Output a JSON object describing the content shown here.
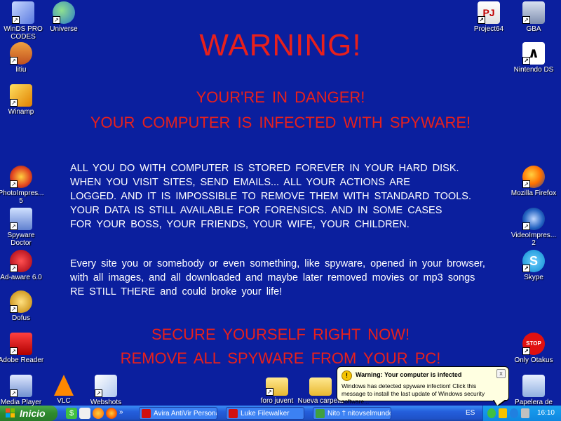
{
  "warning": {
    "title": "WARNING!",
    "danger": "YOUR'RE IN DANGER!",
    "infected": "YOUR COMPUTER IS INFECTED WITH SPYWARE!",
    "para1": [
      "ALL YOU DO WITH COMPUTER IS STORED FOREVER IN YOUR HARD DISK.",
      "WHEN YOU VISIT SITES, SEND EMAILS... ALL YOUR ACTIONS ARE",
      "LOGGED. AND IT IS IMPOSSIBLE TO REMOVE THEM WITH STANDARD TOOLS.",
      "YOUR DATA IS STILL AVAILABLE FOR FORENSICS. AND IN SOME CASES",
      "FOR YOUR BOSS, YOUR FRIENDS, YOUR WIFE, YOUR CHILDREN."
    ],
    "para2": [
      "Every site you or somebody or even something, like spyware, opened in your browser,",
      "with all images, and all downloaded and maybe later removed movies or mp3 songs",
      "RE STILL THERE and could broke your life!"
    ],
    "secure": "SECURE YOURSELF RIGHT NOW!",
    "remove": "REMOVE ALL SPYWARE FROM YOUR PC!"
  },
  "icons": {
    "winds": "WinDS PRO CODES",
    "universe": "Universe",
    "project64": "Project64",
    "gba": "GBA",
    "litiu": "litiu",
    "nintendo": "Nintendo DS",
    "winamp": "Winamp",
    "photoimpress": "PhotoImpres... 5",
    "firefox": "Mozilla Firefox",
    "spyware_doctor": "Spyware Doctor",
    "videoimpress": "VideoImpres... 2",
    "adaware": "Ad-aware 6.0",
    "skype": "Skype",
    "dofus": "Dofus",
    "adobe": "Adobe Reader",
    "only_otakus": "Only Otakus",
    "media_player": "Media Player",
    "vlc": "VLC",
    "webshots": "Webshots",
    "foro": "foro juvent",
    "nueva": "Nueva carpeta",
    "papelera": "Papelera de"
  },
  "balloon": {
    "title": "Warning: Your computer is infected",
    "body": "Windows has detected spyware infection! Click this message to install the last update of Windows security software...",
    "close": "x",
    "icon": "!"
  },
  "taskbar": {
    "start": "Inicio",
    "more": "»",
    "tasks": [
      "Avira AntiVir Personal...",
      "Luke Filewalker",
      "Nito † nitovselmundo...."
    ],
    "lang": "ES",
    "clock": "16:10"
  }
}
